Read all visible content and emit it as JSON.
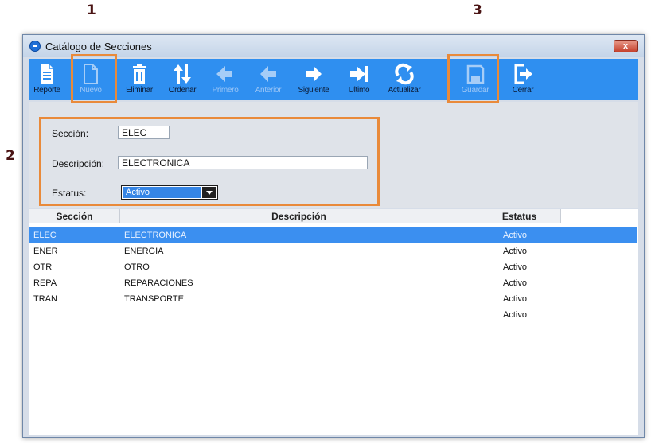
{
  "callouts": [
    "1",
    "2",
    "3"
  ],
  "window": {
    "title": "Catálogo de Secciones",
    "close_glyph": "x"
  },
  "toolbar": {
    "buttons": [
      {
        "label": "Reporte",
        "icon": "document-icon",
        "enabled": true
      },
      {
        "label": "Nuevo",
        "icon": "new-file-icon",
        "enabled": false
      },
      {
        "label": "Eliminar",
        "icon": "trash-icon",
        "enabled": true
      },
      {
        "label": "Ordenar",
        "icon": "sort-arrows-icon",
        "enabled": true
      },
      {
        "label": "Primero",
        "icon": "first-arrow-icon",
        "enabled": false
      },
      {
        "label": "Anterior",
        "icon": "previous-arrow-icon",
        "enabled": false
      },
      {
        "label": "Siguiente",
        "icon": "next-arrow-icon",
        "enabled": true
      },
      {
        "label": "Ultimo",
        "icon": "last-arrow-icon",
        "enabled": true
      },
      {
        "label": "Actualizar",
        "icon": "refresh-icon",
        "enabled": true
      },
      {
        "label": "Guardar",
        "icon": "save-icon",
        "enabled": false
      },
      {
        "label": "Cerrar",
        "icon": "exit-icon",
        "enabled": true
      }
    ]
  },
  "form": {
    "seccion_label": "Sección:",
    "seccion_value": "ELEC",
    "descripcion_label": "Descripción:",
    "descripcion_value": "ELECTRONICA",
    "estatus_label": "Estatus:",
    "estatus_value": "Activo"
  },
  "table": {
    "columns": [
      "Sección",
      "Descripción",
      "Estatus"
    ],
    "rows": [
      {
        "seccion": "ELEC",
        "descripcion": "ELECTRONICA",
        "estatus": "Activo",
        "selected": true
      },
      {
        "seccion": "ENER",
        "descripcion": "ENERGIA",
        "estatus": "Activo",
        "selected": false
      },
      {
        "seccion": "OTR",
        "descripcion": "OTRO",
        "estatus": "Activo",
        "selected": false
      },
      {
        "seccion": "REPA",
        "descripcion": "REPARACIONES",
        "estatus": "Activo",
        "selected": false
      },
      {
        "seccion": "TRAN",
        "descripcion": "TRANSPORTE",
        "estatus": "Activo",
        "selected": false
      },
      {
        "seccion": "",
        "descripcion": "",
        "estatus": "Activo",
        "selected": false
      }
    ]
  },
  "colors": {
    "toolbar": "#2f8ff0",
    "selection": "#3b8ff0",
    "highlight": "#e98a3a"
  }
}
